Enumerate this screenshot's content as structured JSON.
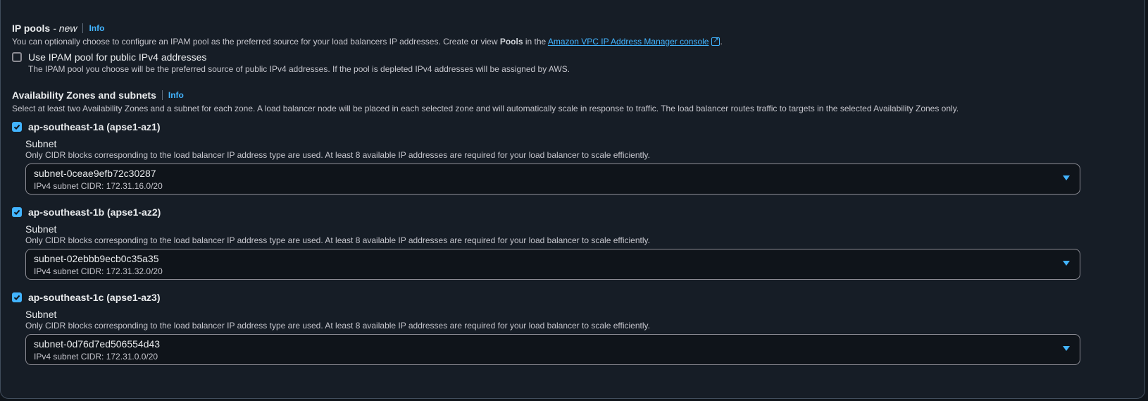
{
  "top_field": {
    "value": ""
  },
  "ip_pools": {
    "title": "IP pools",
    "title_suffix": "- new",
    "info": "Info",
    "desc_prefix": "You can optionally choose to configure an IPAM pool as the preferred source for your load balancers IP addresses. Create or view ",
    "desc_bold": "Pools",
    "desc_middle": " in the ",
    "desc_link": "Amazon VPC IP Address Manager console",
    "desc_end": ".",
    "checkbox_label": "Use IPAM pool for public IPv4 addresses",
    "checkbox_checked": false,
    "checkbox_desc": "The IPAM pool you choose will be the preferred source of public IPv4 addresses. If the pool is depleted IPv4 addresses will be assigned by AWS."
  },
  "az": {
    "title": "Availability Zones and subnets",
    "info": "Info",
    "desc": "Select at least two Availability Zones and a subnet for each zone. A load balancer node will be placed in each selected zone and will automatically scale in response to traffic. The load balancer routes traffic to targets in the selected Availability Zones only.",
    "zones": [
      {
        "label": "ap-southeast-1a (apse1-az1)",
        "checked": true,
        "subnet_title": "Subnet",
        "subnet_desc": "Only CIDR blocks corresponding to the load balancer IP address type are used. At least 8 available IP addresses are required for your load balancer to scale efficiently.",
        "subnet_value": "subnet-0ceae9efb72c30287",
        "subnet_cidr": "IPv4 subnet CIDR: 172.31.16.0/20"
      },
      {
        "label": "ap-southeast-1b (apse1-az2)",
        "checked": true,
        "subnet_title": "Subnet",
        "subnet_desc": "Only CIDR blocks corresponding to the load balancer IP address type are used. At least 8 available IP addresses are required for your load balancer to scale efficiently.",
        "subnet_value": "subnet-02ebbb9ecb0c35a35",
        "subnet_cidr": "IPv4 subnet CIDR: 172.31.32.0/20"
      },
      {
        "label": "ap-southeast-1c (apse1-az3)",
        "checked": true,
        "subnet_title": "Subnet",
        "subnet_desc": "Only CIDR blocks corresponding to the load balancer IP address type are used. At least 8 available IP addresses are required for your load balancer to scale efficiently.",
        "subnet_value": "subnet-0d76d7ed506554d43",
        "subnet_cidr": "IPv4 subnet CIDR: 172.31.0.0/20"
      }
    ]
  },
  "colors": {
    "accent": "#42b4ff",
    "background": "#161d26",
    "border": "#414d5c"
  }
}
